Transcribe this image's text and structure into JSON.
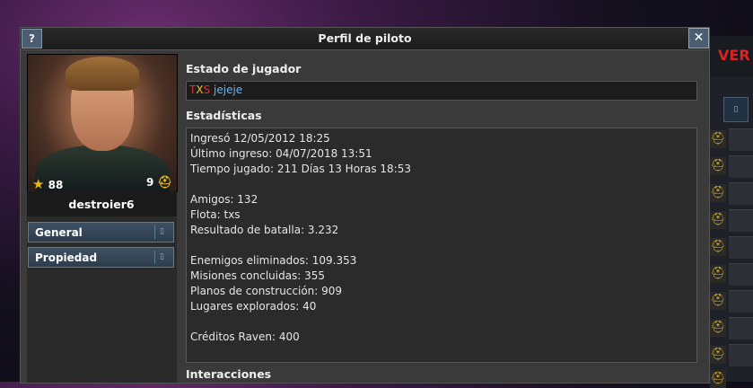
{
  "window": {
    "title": "Perfil de piloto",
    "help_label": "?",
    "close_label": "✕"
  },
  "profile": {
    "username": "destroier6",
    "level": "88",
    "rank_value": "9",
    "nav": [
      {
        "label": "General",
        "arrow": "▯"
      },
      {
        "label": "Propiedad",
        "arrow": "▯"
      }
    ]
  },
  "status": {
    "heading": "Estado de jugador",
    "tag": [
      "T",
      "X",
      "S"
    ],
    "message": "jejeje"
  },
  "stats": {
    "heading": "Estadísticas",
    "lines": [
      "Ingresó 12/05/2012 18:25",
      "Último ingreso: 04/07/2018 13:51",
      "Tiempo jugado: 211 Días  13 Horas  18:53",
      "",
      "Amigos: 132",
      "Flota: txs",
      "Resultado de batalla: 3.232",
      "",
      "Enemigos eliminados: 109.353",
      "Misiones concluidas: 355",
      "Planos de construcción: 909",
      "Lugares explorados: 40",
      "",
      "Créditos Raven: 400"
    ]
  },
  "interactions": {
    "heading": "Interacciones"
  },
  "background": {
    "red_text": "VER",
    "icon_btn": "▯"
  },
  "colors": {
    "accent_button": "#3d5062",
    "status_blue": "#6ab4f0",
    "tag_red": "#e03030",
    "tag_yellow": "#f0c020"
  }
}
